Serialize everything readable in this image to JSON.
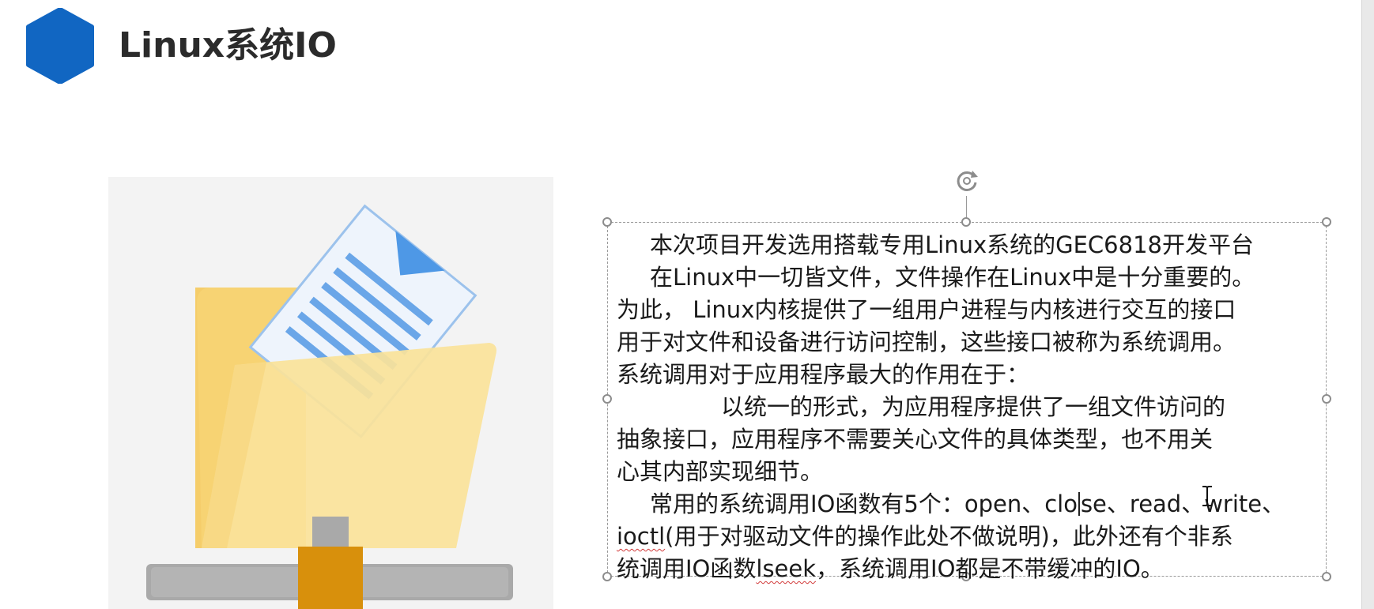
{
  "slide": {
    "title": "Linux系统IO",
    "colors": {
      "accent": "#1166c2",
      "folder": "#f9d77e",
      "document_lines": "#6aa6e8",
      "stand_gray": "#a9a9a9",
      "stand_post": "#d8900c"
    }
  },
  "illustration": {
    "icon": "folder-with-document-icon"
  },
  "textbox": {
    "line1": "本次项目开发选用搭载专用Linux系统的GEC6818开发平台",
    "line2": "在Linux中一切皆文件，文件操作在Linux中是十分重要的。",
    "line3": "为此， Linux内核提供了一组用户进程与内核进行交互的接口",
    "line4": "用于对文件和设备进行访问控制，这些接口被称为系统调用。",
    "line5": "系统调用对于应用程序最大的作用在于：",
    "line6": "以统一的形式，为应用程序提供了一组文件访问的",
    "line7": "抽象接口，应用程序不需要关心文件的具体类型，也不用关",
    "line8": "心其内部实现细节。",
    "line9_a": "常用的系统调用IO函数有5个：open、clo",
    "line9_b": "se、read、write、",
    "line10_a": "ioctl",
    "line10_b": "(用于对驱动文件的操作此处不做说明)，此外还有个非系",
    "line11_a": "统调用IO函数",
    "line11_b": "lseek",
    "line11_c": "，系统调用IO都是不带缓冲的IO。"
  },
  "icons": {
    "rotate": "rotate-handle-icon",
    "cursor": "text-cursor-icon",
    "logo": "hexagon-logo-icon"
  }
}
